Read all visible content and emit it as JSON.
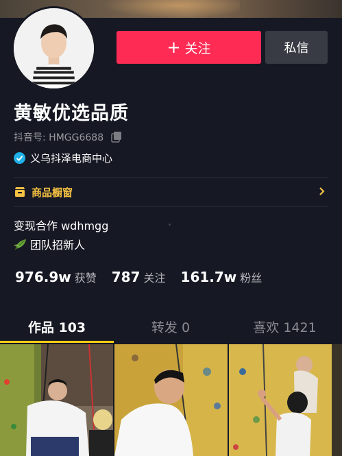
{
  "header": {
    "follow_label": "关注",
    "message_label": "私信"
  },
  "profile": {
    "name": "黄敏优选品质",
    "douyin_id": "抖音号: HMGG6688",
    "verified_label": "义乌抖泽电商中心"
  },
  "shop": {
    "label": "商品橱窗"
  },
  "bio": {
    "line1": "变现合作 wdhmgg",
    "line2": "团队招新人"
  },
  "stats": [
    {
      "value": "976.9w",
      "label": "获赞"
    },
    {
      "value": "787",
      "label": "关注"
    },
    {
      "value": "161.7w",
      "label": "粉丝"
    }
  ],
  "tabs": [
    {
      "label": "作品 103"
    },
    {
      "label": "转发 0"
    },
    {
      "label": "喜欢 1421"
    }
  ],
  "colors": {
    "accent": "#fe2c55",
    "tab_indicator": "#face15",
    "shop": "#f6c243",
    "background": "#161823"
  }
}
